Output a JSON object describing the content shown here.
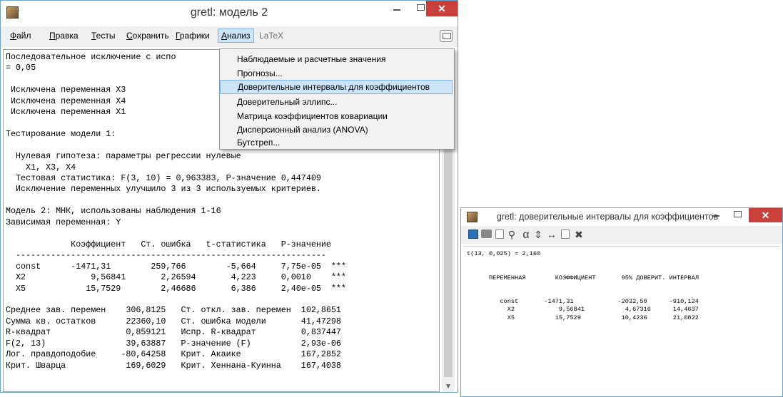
{
  "window1": {
    "title": "gretl: модель 2",
    "menu": [
      "Файл",
      "Правка",
      "Тесты",
      "Сохранить",
      "Графики",
      "Анализ",
      "LaTeX"
    ],
    "output_lines": [
      "Последовательное исключение с испо",
      "= 0,05",
      "",
      " Исключена переменная X3",
      " Исключена переменная X4",
      " Исключена переменная X1",
      "",
      "Тестирование модели 1:",
      "",
      "  Нулевая гипотеза: параметры регрессии нулевые",
      "    X1, X3, X4",
      "  Тестовая статистика: F(3, 10) = 0,963383, P-значение 0,447409",
      "  Исключение переменных улучшило 3 из 3 используемых критериев.",
      "",
      "Модель 2: МНК, использованы наблюдения 1-16",
      "Зависимая переменная: Y",
      "",
      "             Коэффициент   Ст. ошибка   t-статистика   P-значение",
      "  --------------------------------------------------------------",
      "  const      -1471,31        259,766        -5,664     7,75e-05  ***",
      "  X2             9,56841       2,26594       4,223     0,0010    ***",
      "  X5            15,7529        2,46686       6,386     2,40e-05  ***",
      "",
      "Среднее зав. перемен    306,8125   Ст. откл. зав. перемен  102,8651",
      "Сумма кв. остатков      22360,10   Ст. ошибка модели       41,47298",
      "R-квадрат               0,859121   Испр. R-квадрат         0,837447",
      "F(2, 13)                39,63887   Р-значение (F)          2,93e-06",
      "Лог. правдоподобие     -80,64258   Крит. Акаике            167,2852",
      "Крит. Шварца            169,6029   Крит. Хеннана-Куинна    167,4038"
    ],
    "dropdown": [
      "Наблюдаемые и расчетные значения",
      "Прогнозы...",
      "Доверительные интервалы для коэффициентов",
      "Доверительный эллипс...",
      "Матрица коэффициентов ковариации",
      "Дисперсионный анализ (ANOVA)",
      "Бутстреп..."
    ]
  },
  "window2": {
    "title": "gretl: доверительные интервалы для коэффициентов",
    "output_lines": [
      "t(13, 0,025) = 2,160",
      "",
      "",
      "      ПЕРЕМЕННАЯ        КОЭФФИЦИЕНТ       95% ДОВЕРИТ. ИНТЕРВАЛ",
      "",
      "",
      "         const       -1471,31            -2032,50      -910,124",
      "           X2            9,56841           4,67316      14,4637",
      "           X5           15,7529           10,4236       21,0822"
    ]
  },
  "icons": {
    "close": "✕",
    "alpha": "α",
    "updown": "⇕",
    "arrows": "↔",
    "delete": "✖"
  },
  "colors": {
    "close_button": "#c9403a",
    "highlight": "#cce4f7",
    "window_border": "#6aa3d6"
  }
}
